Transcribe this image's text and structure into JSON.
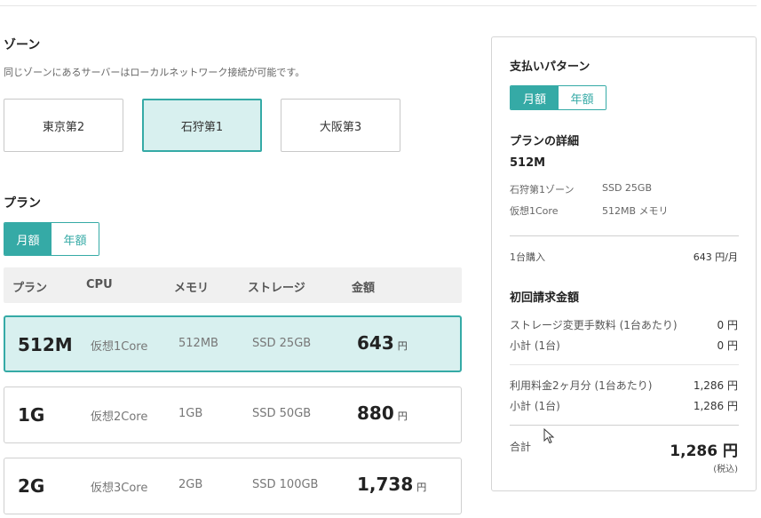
{
  "zone": {
    "title": "ゾーン",
    "description": "同じゾーンにあるサーバーはローカルネットワーク接続が可能です。",
    "options": [
      "東京第2",
      "石狩第1",
      "大阪第3"
    ],
    "selected": "石狩第1"
  },
  "plan": {
    "title": "プラン",
    "billing_toggle": {
      "monthly": "月額",
      "yearly": "年額",
      "selected": "月額"
    },
    "columns": [
      "プラン",
      "CPU",
      "メモリ",
      "ストレージ",
      "金額"
    ],
    "rows": [
      {
        "name": "512M",
        "cpu": "仮想1Core",
        "memory": "512MB",
        "storage": "SSD 25GB",
        "price": "643",
        "unit": "円",
        "selected": true
      },
      {
        "name": "1G",
        "cpu": "仮想2Core",
        "memory": "1GB",
        "storage": "SSD 50GB",
        "price": "880",
        "unit": "円",
        "selected": false
      },
      {
        "name": "2G",
        "cpu": "仮想3Core",
        "memory": "2GB",
        "storage": "SSD 100GB",
        "price": "1,738",
        "unit": "円",
        "selected": false
      }
    ]
  },
  "summary": {
    "payment_title": "支払いパターン",
    "payment_toggle": {
      "monthly": "月額",
      "yearly": "年額",
      "selected": "月額"
    },
    "details_title": "プランの詳細",
    "plan_name": "512M",
    "zone_label": "石狩第1ゾーン",
    "storage": "SSD 25GB",
    "cpu": "仮想1Core",
    "memory": "512MB メモリ",
    "per_unit_label": "1台購入",
    "per_unit_value": "643 円/月",
    "initial_title": "初回請求金額",
    "storage_fee_label": "ストレージ変更手数料 (1台あたり)",
    "storage_fee_value": "0 円",
    "subtotal1_label": "小計 (1台)",
    "subtotal1_value": "0 円",
    "usage_label": "利用料金2ヶ月分 (1台あたり)",
    "usage_value": "1,286 円",
    "subtotal2_label": "小計 (1台)",
    "subtotal2_value": "1,286 円",
    "total_label": "合計",
    "total_value": "1,286 円",
    "tax_note": "(税込)"
  },
  "colors": {
    "accent": "#35aaa6",
    "selected_bg": "#d8f0ef",
    "header_bg": "#f0f0f0"
  }
}
